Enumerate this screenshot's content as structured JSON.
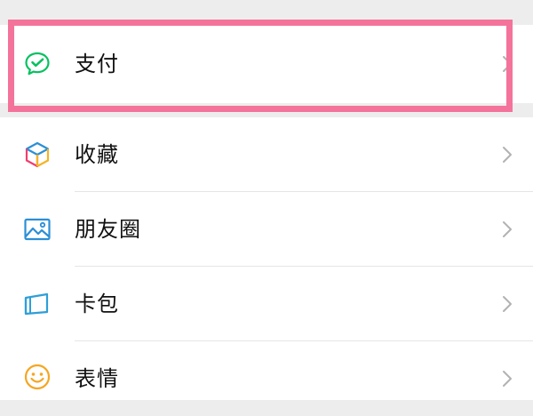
{
  "menu": {
    "items": [
      {
        "label": "支付",
        "icon": "wechat-pay-icon",
        "highlighted": true
      },
      {
        "label": "收藏",
        "icon": "favorites-cube-icon"
      },
      {
        "label": "朋友圈",
        "icon": "moments-picture-icon"
      },
      {
        "label": "卡包",
        "icon": "card-wallet-icon"
      },
      {
        "label": "表情",
        "icon": "sticker-smiley-icon"
      }
    ]
  },
  "highlight": {
    "color": "#f4739b",
    "target": "支付"
  },
  "colors": {
    "background": "#ededed",
    "row": "#ffffff",
    "pay_green": "#07c160",
    "moments_blue": "#2b8fd6",
    "card_blue": "#2e9fd8",
    "sticker_orange": "#f5a623"
  }
}
